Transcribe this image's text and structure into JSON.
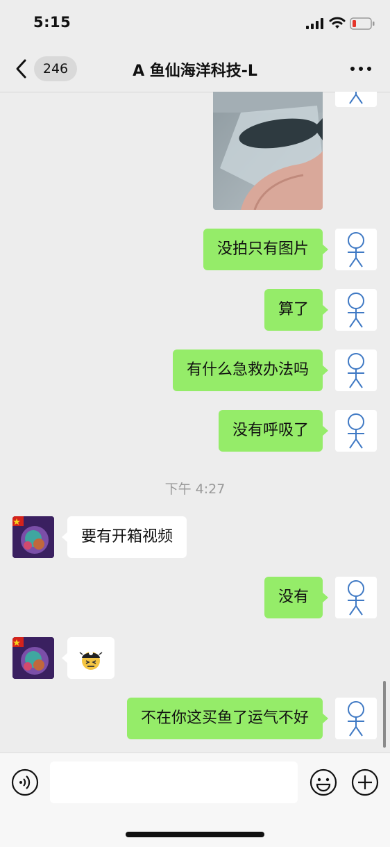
{
  "status_bar": {
    "time": "5:15"
  },
  "nav": {
    "unread_count": "246",
    "title": "A 鱼仙海洋科技-L"
  },
  "messages": {
    "m1": "没拍只有图片",
    "m2": "算了",
    "m3": "有什么急救办法吗",
    "m4": "没有呼吸了",
    "timestamp": "下午 4:27",
    "m5": "要有开箱视频",
    "m6": "没有",
    "m8": "不在你这买鱼了运气不好"
  },
  "icons": {
    "back": "chevron-left-icon",
    "more": "more-dots-icon",
    "voice": "voice-icon",
    "emoji": "emoji-icon",
    "plus": "plus-icon",
    "self_avatar": "stick-figure-avatar",
    "other_avatar": "flag-avatar",
    "sticker": "tired-face-sticker"
  },
  "colors": {
    "my_bubble": "#95ec69",
    "their_bubble": "#ffffff",
    "background": "#ededed",
    "self_avatar_stroke": "#3f79c4"
  }
}
